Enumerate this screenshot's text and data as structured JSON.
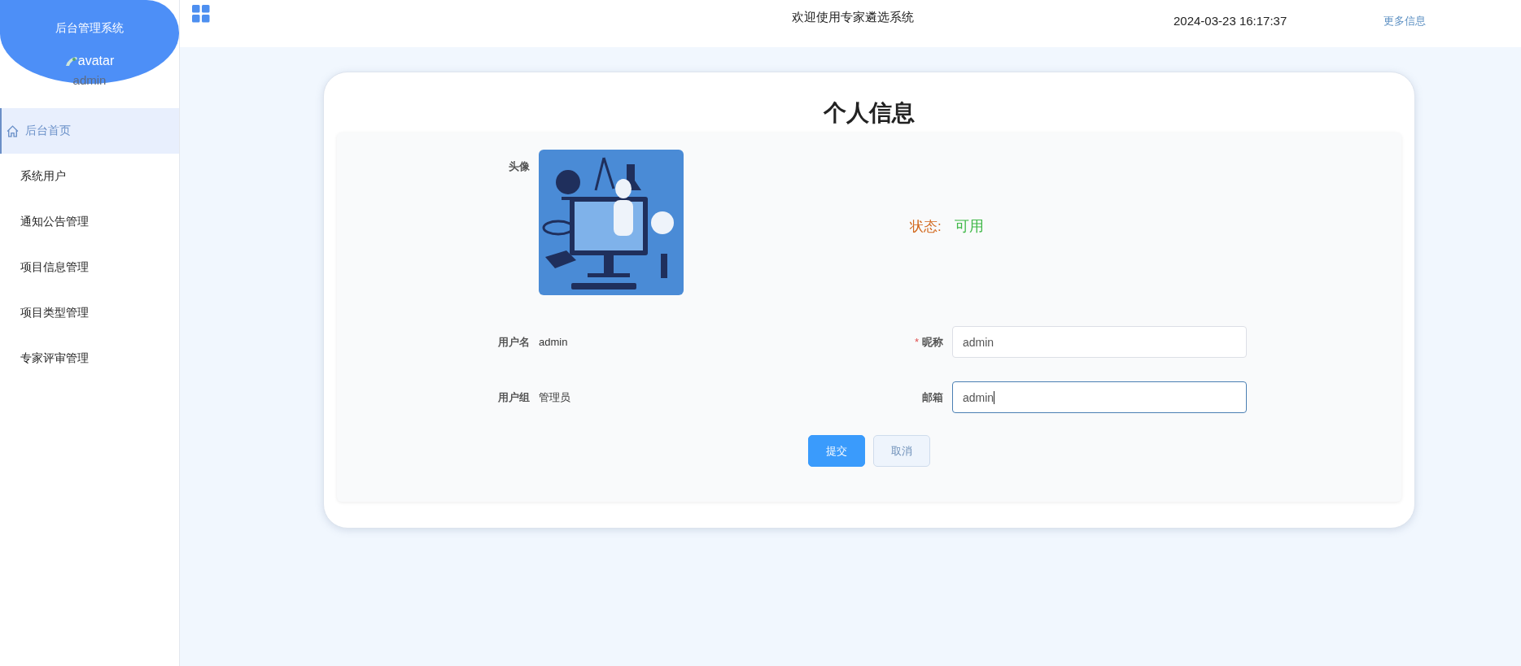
{
  "sidebar": {
    "title": "后台管理系统",
    "avatar_alt": "avatar",
    "username": "admin",
    "items": [
      {
        "label": "后台首页",
        "selected": true,
        "kind": "home"
      },
      {
        "label": "系统用户",
        "selected": false,
        "kind": "plain"
      },
      {
        "label": "通知公告管理",
        "selected": false,
        "kind": "plain"
      },
      {
        "label": "项目信息管理",
        "selected": false,
        "kind": "plain"
      },
      {
        "label": "项目类型管理",
        "selected": false,
        "kind": "plain"
      },
      {
        "label": "专家评审管理",
        "selected": false,
        "kind": "plain"
      }
    ]
  },
  "header": {
    "welcome": "欢迎使用专家遴选系统",
    "datetime": "2024-03-23 16:17:37",
    "more_link": "更多信息"
  },
  "profile": {
    "title": "个人信息",
    "avatar_label": "头像",
    "required_mark": "*",
    "status_label": "状态:",
    "status_value": "可用",
    "fields": [
      {
        "label": "用户名",
        "value": "admin",
        "kind": "text"
      },
      {
        "label": "昵称",
        "value": "admin",
        "kind": "input",
        "required": true,
        "focused": false
      },
      {
        "label": "用户组",
        "value": "管理员",
        "kind": "text"
      },
      {
        "label": "邮箱",
        "value": "admin",
        "kind": "input",
        "required": false,
        "focused": true
      }
    ],
    "buttons": [
      {
        "label": "提交",
        "kind": "primary"
      },
      {
        "label": "取消",
        "kind": "plain"
      }
    ]
  }
}
